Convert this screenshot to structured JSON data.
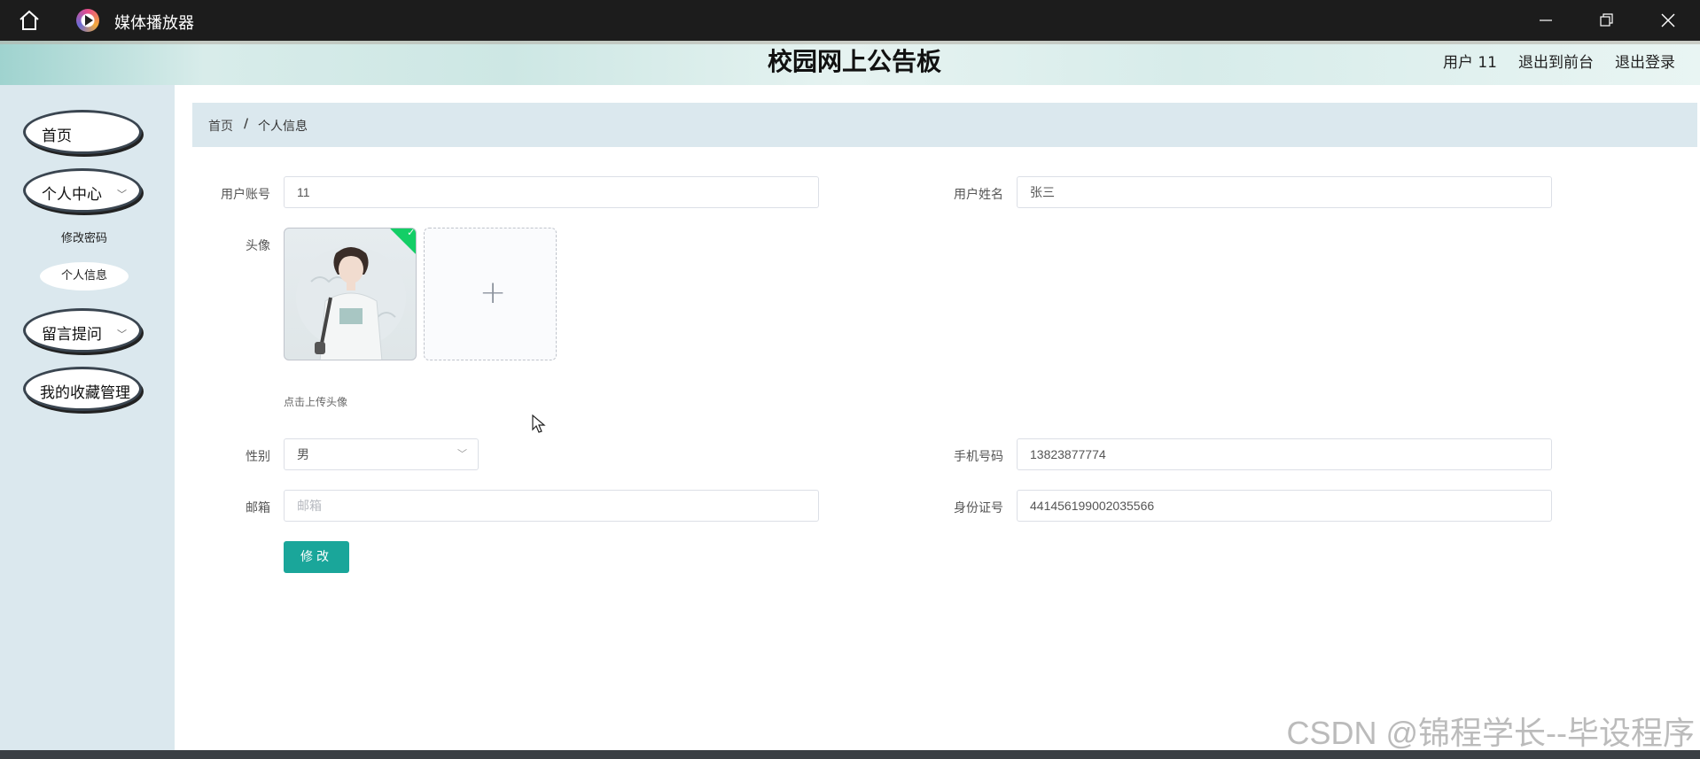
{
  "window": {
    "title": "媒体播放器"
  },
  "header": {
    "site_title": "校园网上公告板",
    "user_label": "用户 11",
    "back_to_front": "退出到前台",
    "logout": "退出登录"
  },
  "sidebar": {
    "items": [
      {
        "label": "首页",
        "has_children": false
      },
      {
        "label": "个人中心",
        "has_children": true
      },
      {
        "label": "留言提问",
        "has_children": true
      },
      {
        "label": "我的收藏管理",
        "has_children": false
      }
    ],
    "sub_items": [
      {
        "label": "修改密码",
        "active": false
      },
      {
        "label": "个人信息",
        "active": true
      }
    ]
  },
  "breadcrumb": {
    "home": "首页",
    "separator": "/",
    "current": "个人信息"
  },
  "form": {
    "account_label": "用户账号",
    "account_value": "11",
    "name_label": "用户姓名",
    "name_value": "张三",
    "avatar_label": "头像",
    "avatar_hint": "点击上传头像",
    "gender_label": "性别",
    "gender_value": "男",
    "phone_label": "手机号码",
    "phone_value": "13823877774",
    "email_label": "邮箱",
    "email_placeholder": "邮箱",
    "id_label": "身份证号",
    "id_value": "441456199002035566",
    "submit_label": "修改"
  },
  "watermark": "CSDN @锦程学长--毕设程序",
  "colors": {
    "accent": "#1aa69a",
    "sidebar_bg": "#dbe8ee",
    "titlebar_bg": "#1c1c1c",
    "success": "#13ce66"
  },
  "icons": [
    "home-icon",
    "media-player-icon",
    "minimize-icon",
    "restore-icon",
    "close-icon",
    "chevron-down-icon",
    "plus-icon",
    "check-icon"
  ]
}
